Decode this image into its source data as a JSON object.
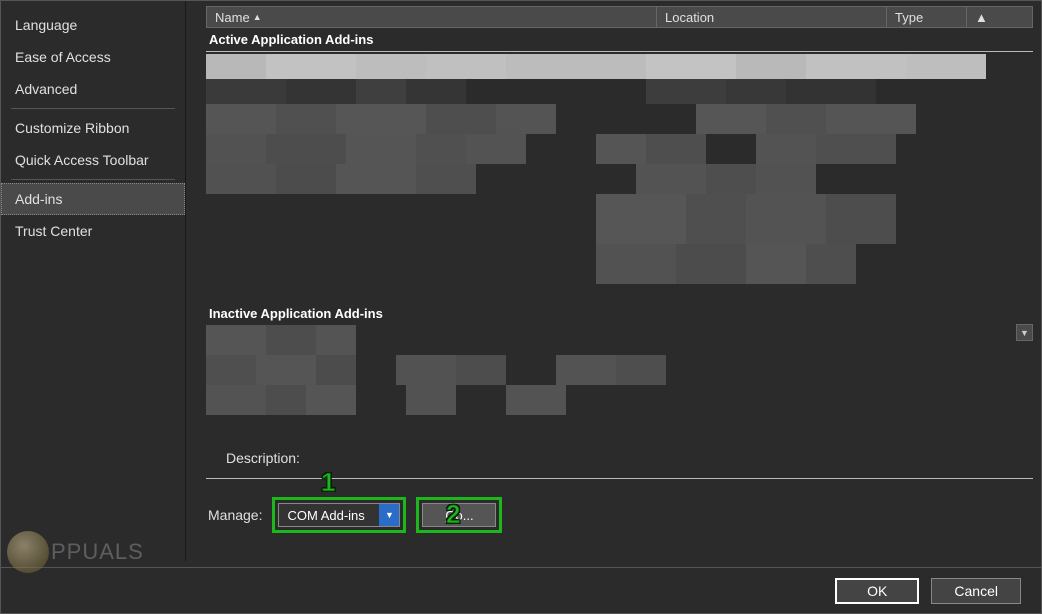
{
  "sidebar": {
    "items": [
      {
        "label": "Language"
      },
      {
        "label": "Ease of Access"
      },
      {
        "label": "Advanced"
      },
      {
        "label": "Customize Ribbon"
      },
      {
        "label": "Quick Access Toolbar"
      },
      {
        "label": "Add-ins"
      },
      {
        "label": "Trust Center"
      }
    ]
  },
  "columns": {
    "name": "Name",
    "location": "Location",
    "type": "Type"
  },
  "groups": {
    "active": "Active Application Add-ins",
    "inactive": "Inactive Application Add-ins"
  },
  "description_label": "Description:",
  "manage": {
    "label": "Manage:",
    "selected": "COM Add-ins",
    "go_prefix": "G",
    "go_suffix": "o..."
  },
  "callouts": {
    "one": "1",
    "two": "2"
  },
  "footer": {
    "ok": "OK",
    "cancel": "Cancel"
  },
  "watermark": {
    "text": "PPUALS"
  }
}
